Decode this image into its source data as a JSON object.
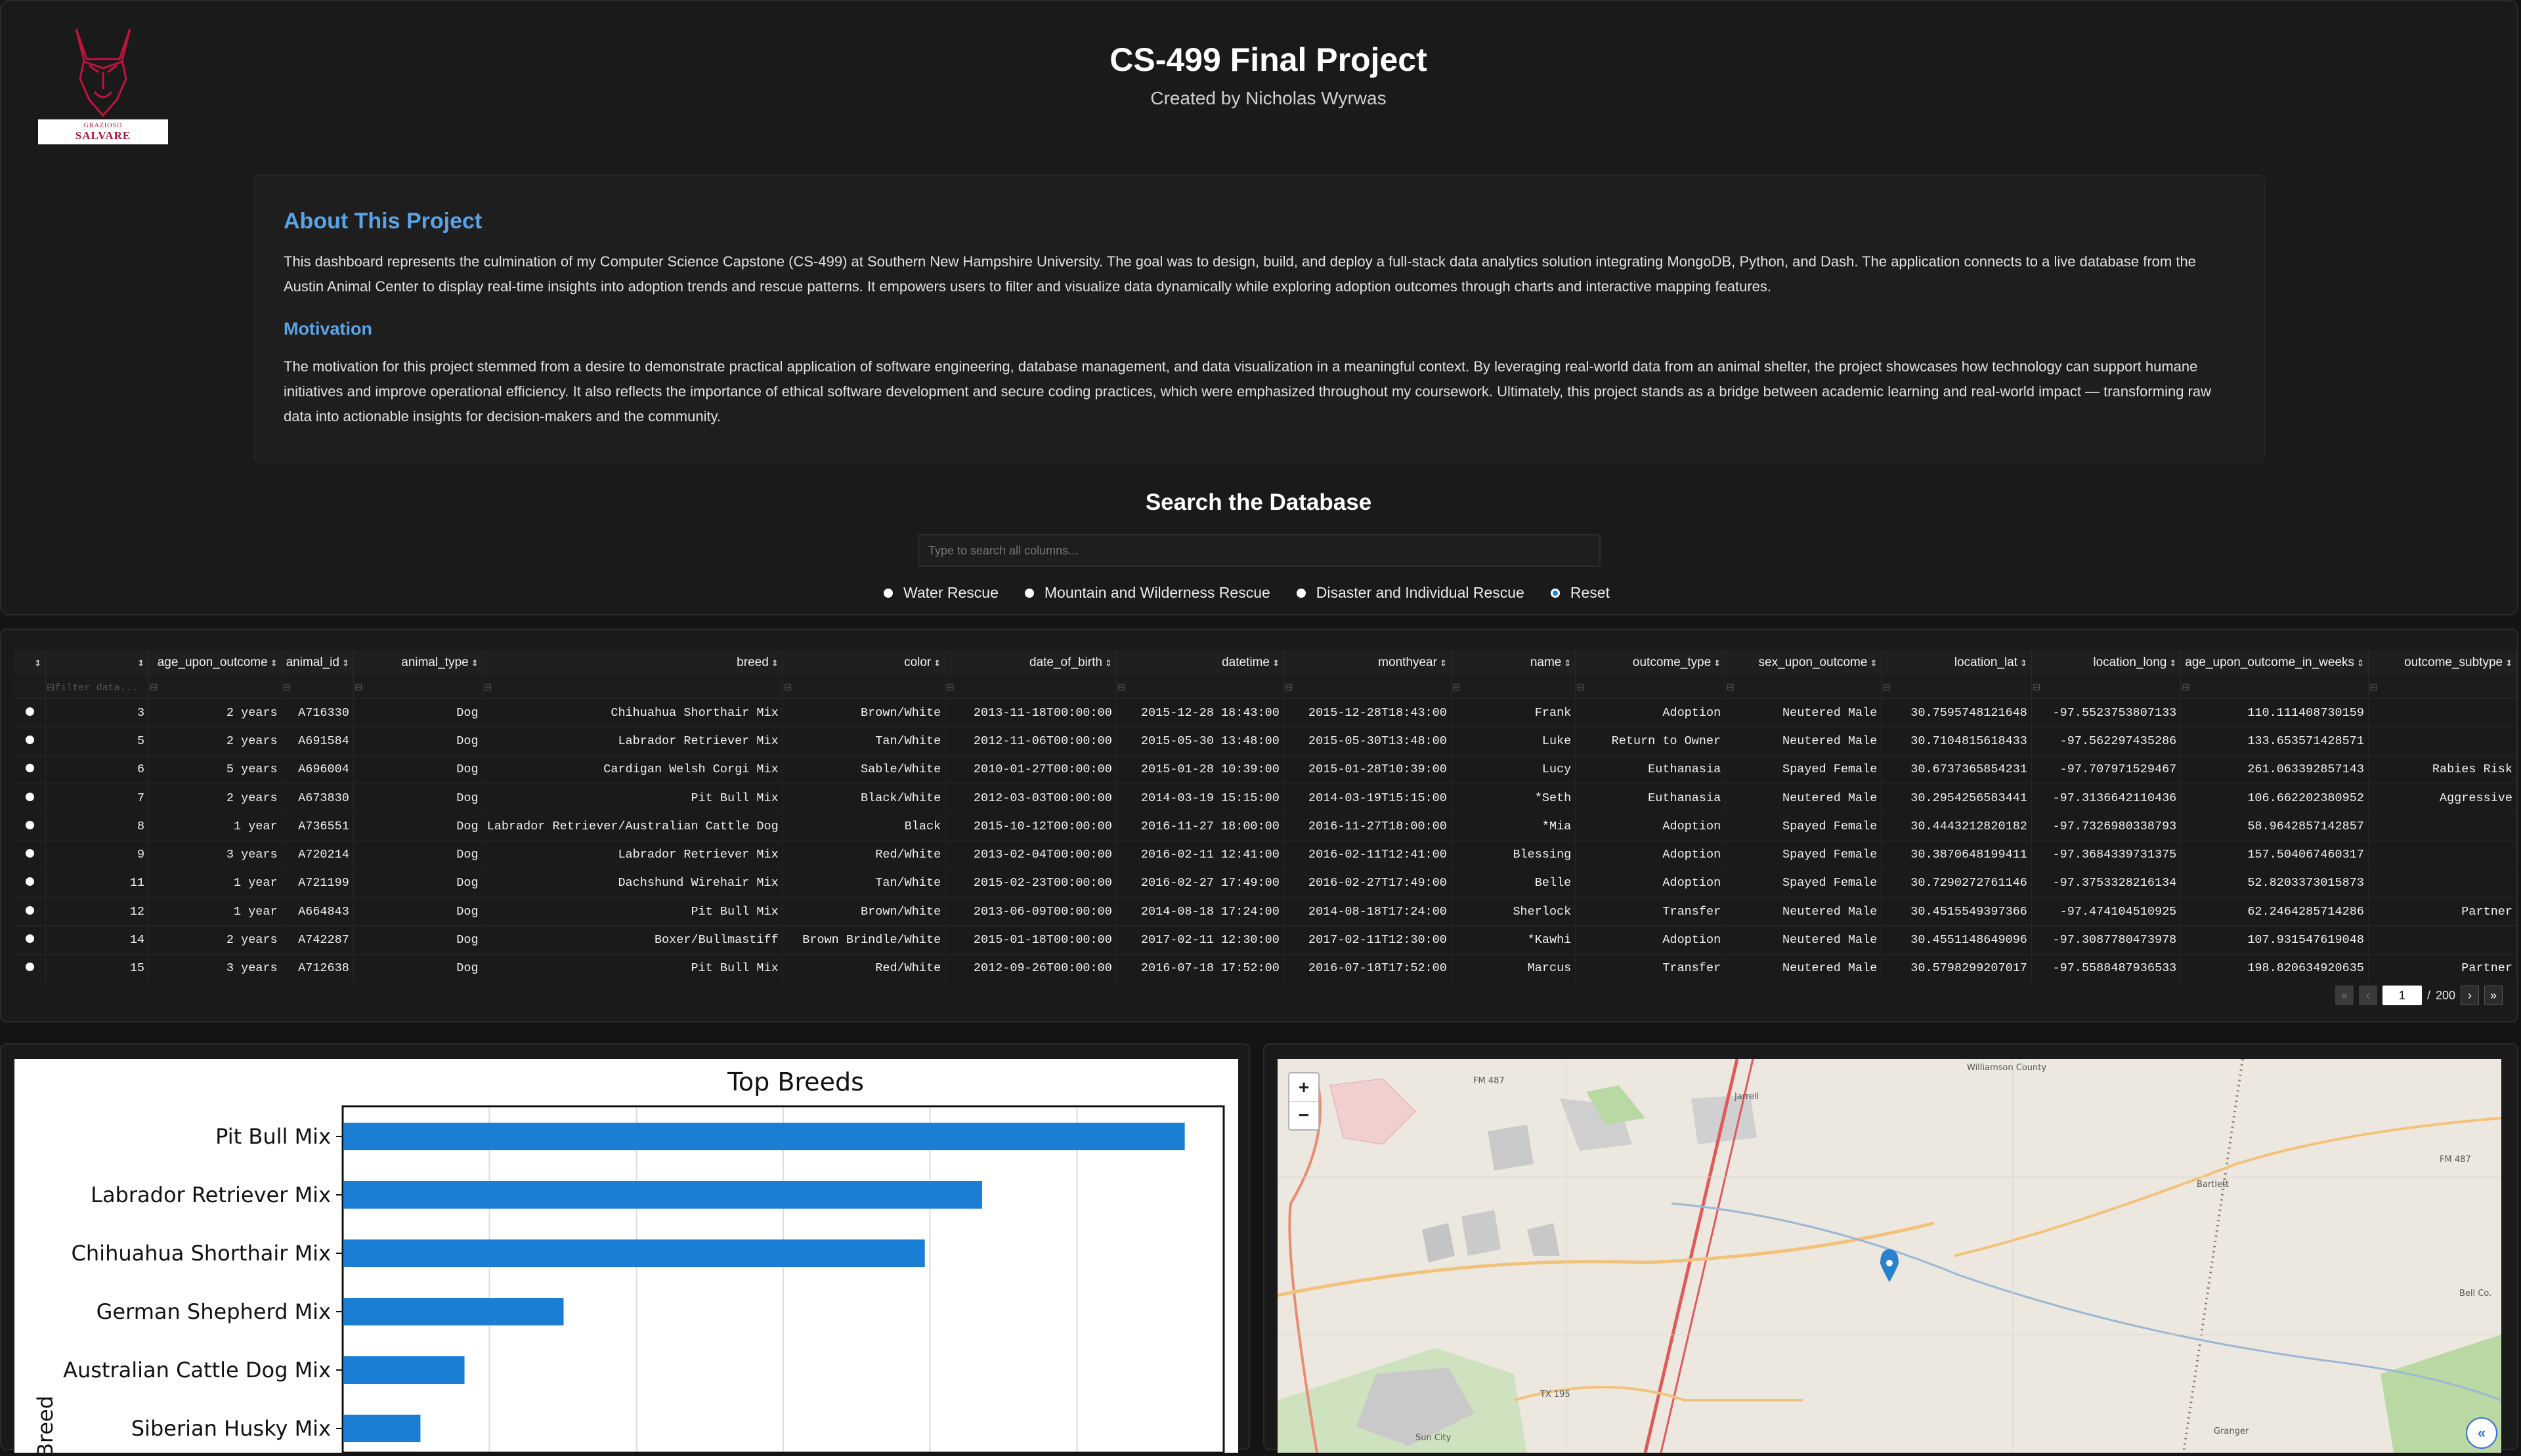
{
  "header": {
    "title": "CS-499 Final Project",
    "subtitle": "Created by Nicholas Wyrwas",
    "logo_line1": "GRAZIOSO",
    "logo_line2": "SALVARE"
  },
  "about": {
    "heading": "About This Project",
    "text": "This dashboard represents the culmination of my Computer Science Capstone (CS-499) at Southern New Hampshire University. The goal was to design, build, and deploy a full-stack data analytics solution integrating MongoDB, Python, and Dash. The application connects to a live database from the Austin Animal Center to display real-time insights into adoption trends and rescue patterns. It empowers users to filter and visualize data dynamically while exploring adoption outcomes through charts and interactive mapping features.",
    "motivation_heading": "Motivation",
    "motivation_text": "The motivation for this project stemmed from a desire to demonstrate practical application of software engineering, database management, and data visualization in a meaningful context. By leveraging real-world data from an animal shelter, the project showcases how technology can support humane initiatives and improve operational efficiency. It also reflects the importance of ethical software development and secure coding practices, which were emphasized throughout my coursework. Ultimately, this project stands as a bridge between academic learning and real-world impact — transforming raw data into actionable insights for decision-makers and the community."
  },
  "search": {
    "title": "Search the Database",
    "placeholder": "Type to search all columns...",
    "options": [
      "Water Rescue",
      "Mountain and Wilderness Rescue",
      "Disaster and Individual Rescue",
      "Reset"
    ],
    "selected": "Reset"
  },
  "table": {
    "columns": [
      "",
      "age_upon_outcome",
      "animal_id",
      "animal_type",
      "breed",
      "color",
      "date_of_birth",
      "datetime",
      "monthyear",
      "name",
      "outcome_type",
      "sex_upon_outcome",
      "location_lat",
      "location_long",
      "age_upon_outcome_in_weeks",
      "outcome_subtype"
    ],
    "filter_placeholder": "filter data...",
    "rows": [
      [
        "3",
        "2 years",
        "A716330",
        "Dog",
        "Chihuahua Shorthair Mix",
        "Brown/White",
        "2013-11-18T00:00:00",
        "2015-12-28 18:43:00",
        "2015-12-28T18:43:00",
        "Frank",
        "Adoption",
        "Neutered Male",
        "30.7595748121648",
        "-97.5523753807133",
        "110.111408730159",
        ""
      ],
      [
        "5",
        "2 years",
        "A691584",
        "Dog",
        "Labrador Retriever Mix",
        "Tan/White",
        "2012-11-06T00:00:00",
        "2015-05-30 13:48:00",
        "2015-05-30T13:48:00",
        "Luke",
        "Return to Owner",
        "Neutered Male",
        "30.7104815618433",
        "-97.562297435286",
        "133.653571428571",
        ""
      ],
      [
        "6",
        "5 years",
        "A696004",
        "Dog",
        "Cardigan Welsh Corgi Mix",
        "Sable/White",
        "2010-01-27T00:00:00",
        "2015-01-28 10:39:00",
        "2015-01-28T10:39:00",
        "Lucy",
        "Euthanasia",
        "Spayed Female",
        "30.6737365854231",
        "-97.707971529467",
        "261.063392857143",
        "Rabies Risk"
      ],
      [
        "7",
        "2 years",
        "A673830",
        "Dog",
        "Pit Bull Mix",
        "Black/White",
        "2012-03-03T00:00:00",
        "2014-03-19 15:15:00",
        "2014-03-19T15:15:00",
        "*Seth",
        "Euthanasia",
        "Neutered Male",
        "30.2954256583441",
        "-97.3136642110436",
        "106.662202380952",
        "Aggressive"
      ],
      [
        "8",
        "1 year",
        "A736551",
        "Dog",
        "Labrador Retriever/Australian Cattle Dog",
        "Black",
        "2015-10-12T00:00:00",
        "2016-11-27 18:00:00",
        "2016-11-27T18:00:00",
        "*Mia",
        "Adoption",
        "Spayed Female",
        "30.4443212820182",
        "-97.7326980338793",
        "58.9642857142857",
        ""
      ],
      [
        "9",
        "3 years",
        "A720214",
        "Dog",
        "Labrador Retriever Mix",
        "Red/White",
        "2013-02-04T00:00:00",
        "2016-02-11 12:41:00",
        "2016-02-11T12:41:00",
        "Blessing",
        "Adoption",
        "Spayed Female",
        "30.3870648199411",
        "-97.3684339731375",
        "157.504067460317",
        ""
      ],
      [
        "11",
        "1 year",
        "A721199",
        "Dog",
        "Dachshund Wirehair Mix",
        "Tan/White",
        "2015-02-23T00:00:00",
        "2016-02-27 17:49:00",
        "2016-02-27T17:49:00",
        "Belle",
        "Adoption",
        "Spayed Female",
        "30.7290272761146",
        "-97.3753328216134",
        "52.8203373015873",
        ""
      ],
      [
        "12",
        "1 year",
        "A664843",
        "Dog",
        "Pit Bull Mix",
        "Brown/White",
        "2013-06-09T00:00:00",
        "2014-08-18 17:24:00",
        "2014-08-18T17:24:00",
        "Sherlock",
        "Transfer",
        "Neutered Male",
        "30.4515549397366",
        "-97.474104510925",
        "62.2464285714286",
        "Partner"
      ],
      [
        "14",
        "2 years",
        "A742287",
        "Dog",
        "Boxer/Bullmastiff",
        "Brown Brindle/White",
        "2015-01-18T00:00:00",
        "2017-02-11 12:30:00",
        "2017-02-11T12:30:00",
        "*Kawhi",
        "Adoption",
        "Neutered Male",
        "30.4551148649096",
        "-97.3087780473978",
        "107.931547619048",
        ""
      ],
      [
        "15",
        "3 years",
        "A712638",
        "Dog",
        "Pit Bull Mix",
        "Red/White",
        "2012-09-26T00:00:00",
        "2016-07-18 17:52:00",
        "2016-07-18T17:52:00",
        "Marcus",
        "Transfer",
        "Neutered Male",
        "30.5798299207017",
        "-97.5588487936533",
        "198.820634920635",
        "Partner"
      ]
    ],
    "pager": {
      "current": "1",
      "separator": "/",
      "total": "200"
    }
  },
  "chart_data": {
    "type": "bar",
    "title": "Top Breeds",
    "ylabel": "Breed",
    "categories": [
      "Pit Bull Mix",
      "Labrador Retriever Mix",
      "Chihuahua Shorthair Mix",
      "German Shepherd Mix",
      "Australian Cattle Dog Mix",
      "Siberian Husky Mix"
    ],
    "values": [
      1910,
      1450,
      1320,
      500,
      275,
      175
    ],
    "xlim": [
      0,
      2000
    ],
    "grid": true,
    "colors": {
      "bar": "#1a7fd3"
    }
  },
  "map": {
    "zoom_in": "+",
    "zoom_out": "−",
    "labels": {
      "fm487": "FM 487",
      "jarrell": "Jarrell",
      "williamson": "Williamson County",
      "bartlett": "Bartlett",
      "fm487b": "FM 487",
      "tx195": "TX 195",
      "suncity": "Sun City",
      "granger": "Granger",
      "bell": "Bell Co."
    },
    "collapse_icon": "«"
  }
}
